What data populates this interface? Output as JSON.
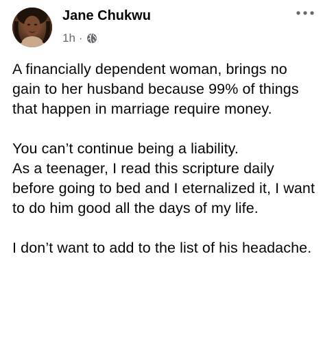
{
  "post": {
    "author": {
      "name": "Jane Chukwu",
      "avatar_icon": "profile-photo"
    },
    "meta": {
      "time": "1h",
      "separator": "·",
      "audience_icon": "globe-icon"
    },
    "menu_icon": "more-options-icon",
    "body": {
      "paragraphs": [
        "A financially dependent woman, brings no gain to her husband because 99% of things that happen in marriage require money.",
        "You can’t continue being a liability.\nAs a teenager, I read this scripture daily before going to bed and I eternalized it, I want to do him good all the days of my life.",
        "I don’t want to add to the list of his headache."
      ]
    },
    "colors": {
      "text": "#050505",
      "secondary": "#65676b",
      "background": "#ffffff"
    }
  }
}
